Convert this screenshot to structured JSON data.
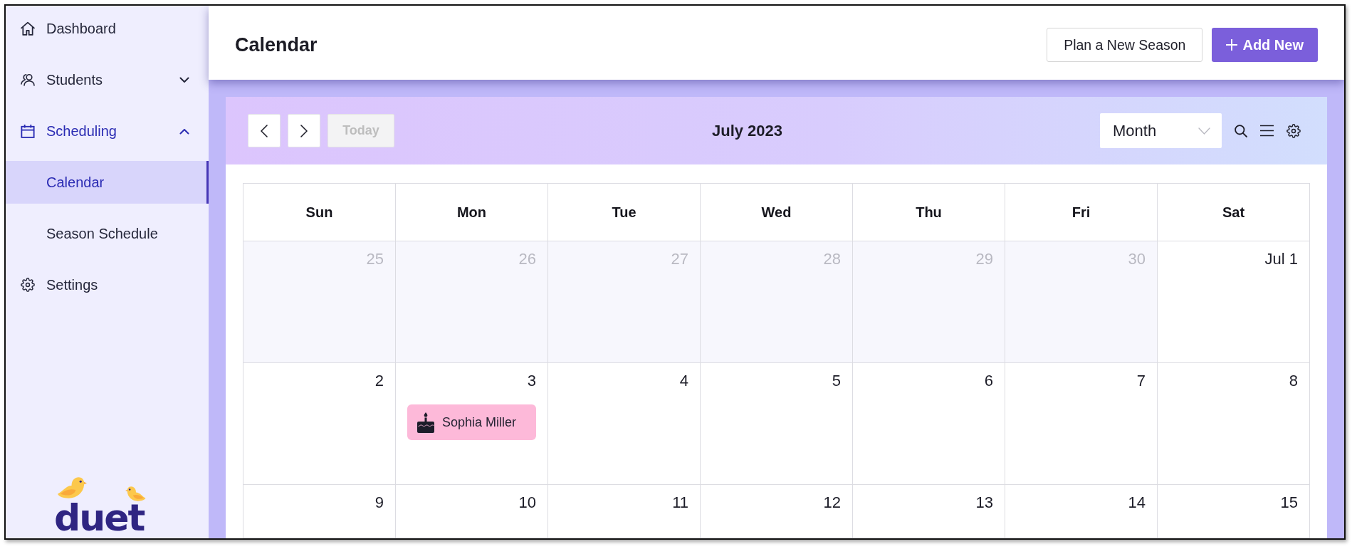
{
  "sidebar": {
    "items": [
      {
        "label": "Dashboard",
        "kind": "link",
        "selected": false
      },
      {
        "label": "Students",
        "kind": "group",
        "selected": false,
        "expanded": false
      },
      {
        "label": "Scheduling",
        "kind": "group",
        "selected": true,
        "expanded": true,
        "children": [
          {
            "label": "Calendar",
            "selected": true
          },
          {
            "label": "Season Schedule",
            "selected": false
          }
        ]
      },
      {
        "label": "Settings",
        "kind": "link",
        "selected": false
      }
    ],
    "logo": "duet"
  },
  "header": {
    "title": "Calendar",
    "buttons": [
      {
        "label": "Plan a New Season",
        "kind": "secondary"
      },
      {
        "label": "Add New",
        "kind": "primary"
      }
    ]
  },
  "calendar": {
    "toolbar": {
      "today": {
        "label": "Today",
        "disabled": true
      },
      "title": "July 2023",
      "view": "Month"
    },
    "weekdays": [
      "Sun",
      "Mon",
      "Tue",
      "Wed",
      "Thu",
      "Fri",
      "Sat"
    ],
    "weeks": [
      {
        "days": [
          {
            "day": "25",
            "other_month": true
          },
          {
            "day": "26",
            "other_month": true
          },
          {
            "day": "27",
            "other_month": true
          },
          {
            "day": "28",
            "other_month": true
          },
          {
            "day": "29",
            "other_month": true
          },
          {
            "day": "30",
            "other_month": true
          },
          {
            "day": "Jul 1",
            "other_month": false
          }
        ]
      },
      {
        "days": [
          {
            "day": "2",
            "other_month": false
          },
          {
            "day": "3",
            "other_month": false,
            "events": [
              {
                "title": "Sophia Miller"
              }
            ]
          },
          {
            "day": "4",
            "other_month": false
          },
          {
            "day": "5",
            "other_month": false
          },
          {
            "day": "6",
            "other_month": false
          },
          {
            "day": "7",
            "other_month": false
          },
          {
            "day": "8",
            "other_month": false
          }
        ]
      },
      {
        "days": [
          {
            "day": "9",
            "other_month": false
          },
          {
            "day": "10",
            "other_month": false
          },
          {
            "day": "11",
            "other_month": false
          },
          {
            "day": "12",
            "other_month": false
          },
          {
            "day": "13",
            "other_month": false
          },
          {
            "day": "14",
            "other_month": false
          },
          {
            "day": "15",
            "other_month": false
          }
        ]
      }
    ]
  }
}
